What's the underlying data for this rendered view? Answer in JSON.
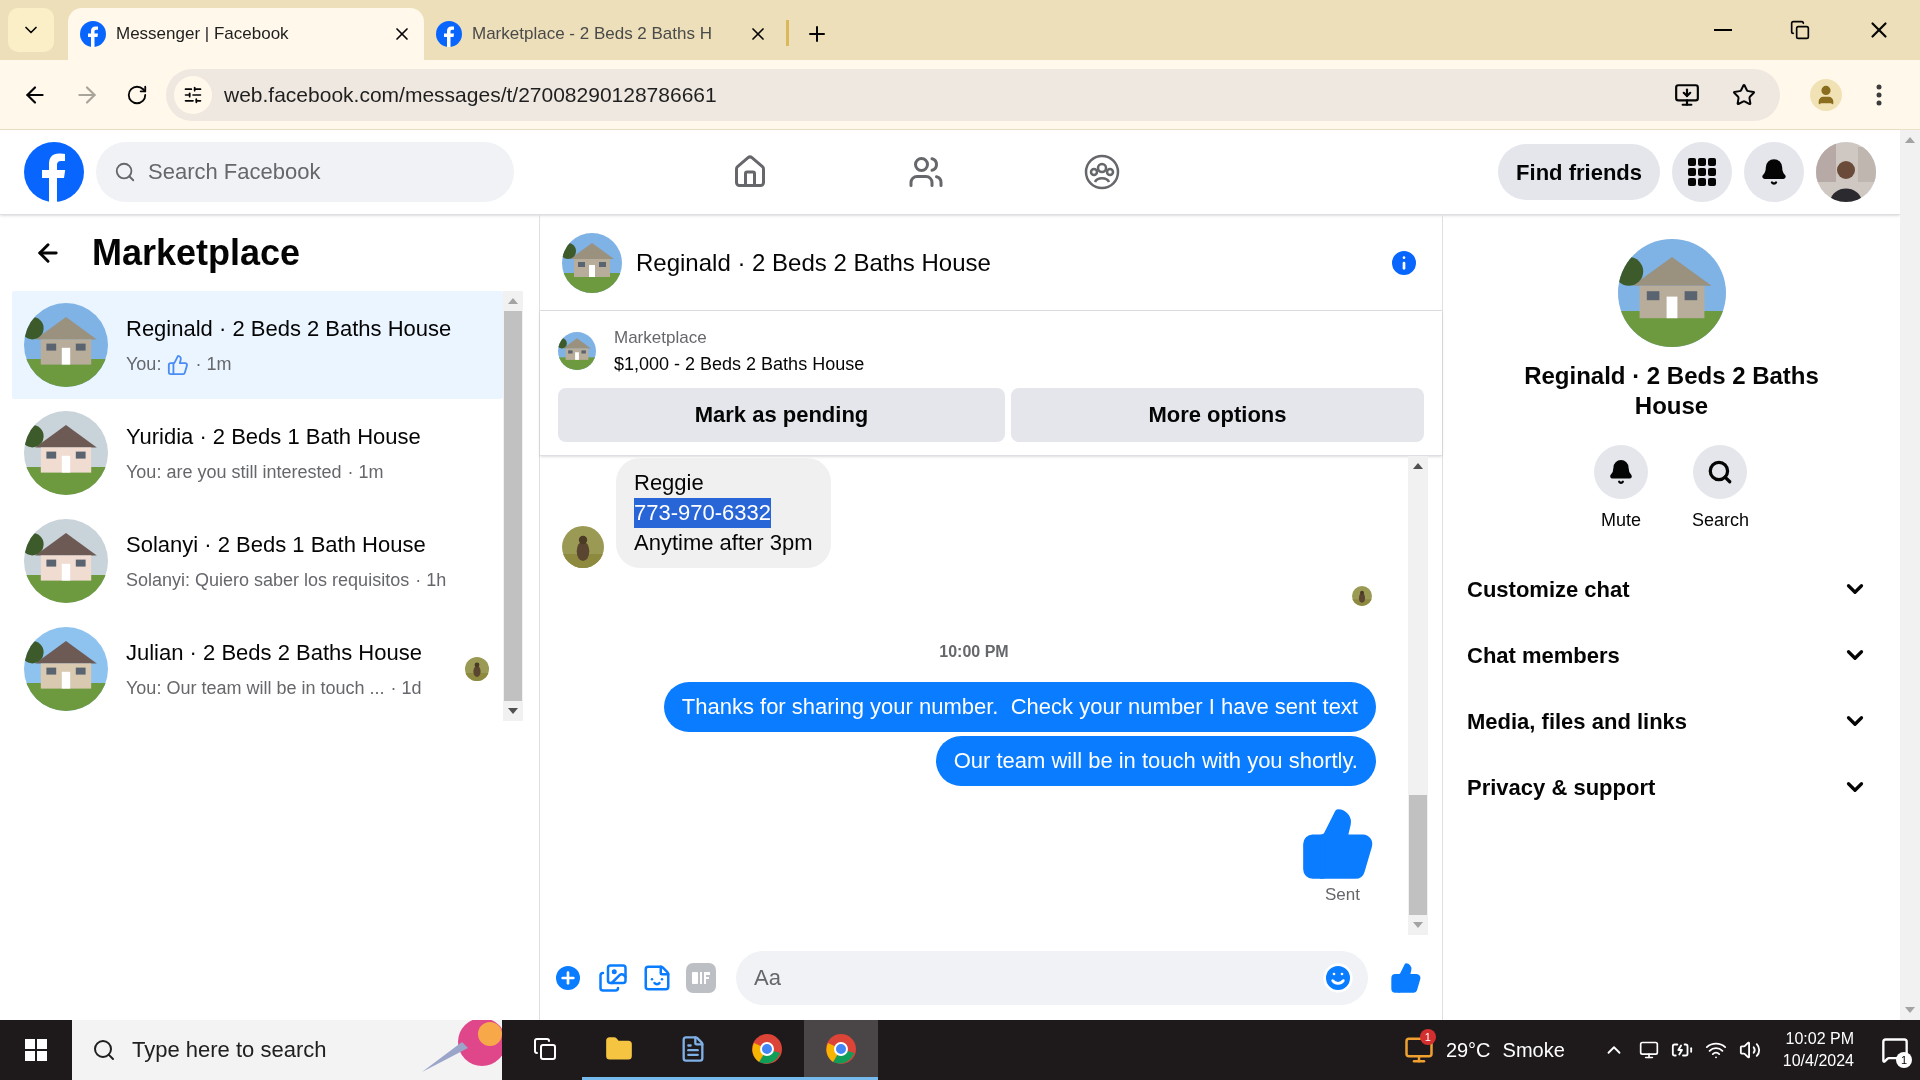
{
  "browser": {
    "tabs": [
      {
        "title": "Messenger | Facebook",
        "selected": true
      },
      {
        "title": "Marketplace - 2 Beds 2 Baths H",
        "selected": false
      }
    ],
    "url": "web.facebook.com/messages/t/27008290128786661"
  },
  "header": {
    "search_placeholder": "Search Facebook",
    "find_friends": "Find friends"
  },
  "sidebar": {
    "title": "Marketplace",
    "conversations": [
      {
        "name": "Reginald · 2 Beds 2 Baths House",
        "kind": "like",
        "preview": "You:",
        "time": "· 1m",
        "selected": true,
        "seen": false
      },
      {
        "name": "Yuridia · 2 Beds 1 Bath House",
        "kind": "text",
        "preview": "You: are you still interested",
        "time": "· 1m",
        "selected": false,
        "seen": false
      },
      {
        "name": "Solanyi · 2 Beds 1 Bath House",
        "kind": "text",
        "preview": "Solanyi: Quiero saber los requisitos",
        "time": "· 1h",
        "selected": false,
        "seen": false
      },
      {
        "name": "Julian · 2 Beds 2 Baths House",
        "kind": "text",
        "preview": "You: Our team will be in touch ...",
        "time": "· 1d",
        "selected": false,
        "seen": true
      }
    ]
  },
  "chat": {
    "title": "Reginald · 2 Beds 2 Baths House",
    "listing": {
      "label": "Marketplace",
      "title": "$1,000 - 2 Beds 2 Baths House"
    },
    "buttons": [
      "Mark as pending",
      "More options"
    ],
    "messages": [
      {
        "kind": "received",
        "lines": [
          {
            "text": "Reggie",
            "selected": false
          },
          {
            "text": "773-970-6332",
            "selected": true
          },
          {
            "text": "Anytime after 3pm",
            "selected": false
          }
        ]
      },
      {
        "kind": "read_receipt"
      },
      {
        "kind": "timestamp",
        "text": "10:00 PM"
      },
      {
        "kind": "sent",
        "text": "Thanks for sharing your number.  Check your number I have sent text"
      },
      {
        "kind": "sent",
        "text": "Our team will be in touch with you shortly."
      },
      {
        "kind": "like",
        "status": "Sent"
      }
    ],
    "composer_placeholder": "Aa"
  },
  "details": {
    "name": "Reginald · 2 Beds 2 Baths House",
    "actions": [
      "Mute",
      "Search"
    ],
    "sections": [
      {
        "label": "Customize chat",
        "expanded": false
      },
      {
        "label": "Chat members",
        "expanded": false
      },
      {
        "label": "Media, files and links",
        "expanded": false
      },
      {
        "label": "Privacy & support",
        "expanded": false
      }
    ]
  },
  "taskbar": {
    "search_placeholder": "Type here to search",
    "apps": [
      {
        "kind": "task_view",
        "running": false,
        "selected": false
      },
      {
        "kind": "explorer",
        "running": true,
        "selected": false
      },
      {
        "kind": "document",
        "running": true,
        "selected": false
      },
      {
        "kind": "browser",
        "running": true,
        "selected": false
      },
      {
        "kind": "browser",
        "running": true,
        "selected": true
      }
    ],
    "weather_badge": "1",
    "temperature": "29°C",
    "weather": "Smoke",
    "time": "10:02 PM",
    "date": "10/4/2024",
    "notifications": "1"
  }
}
